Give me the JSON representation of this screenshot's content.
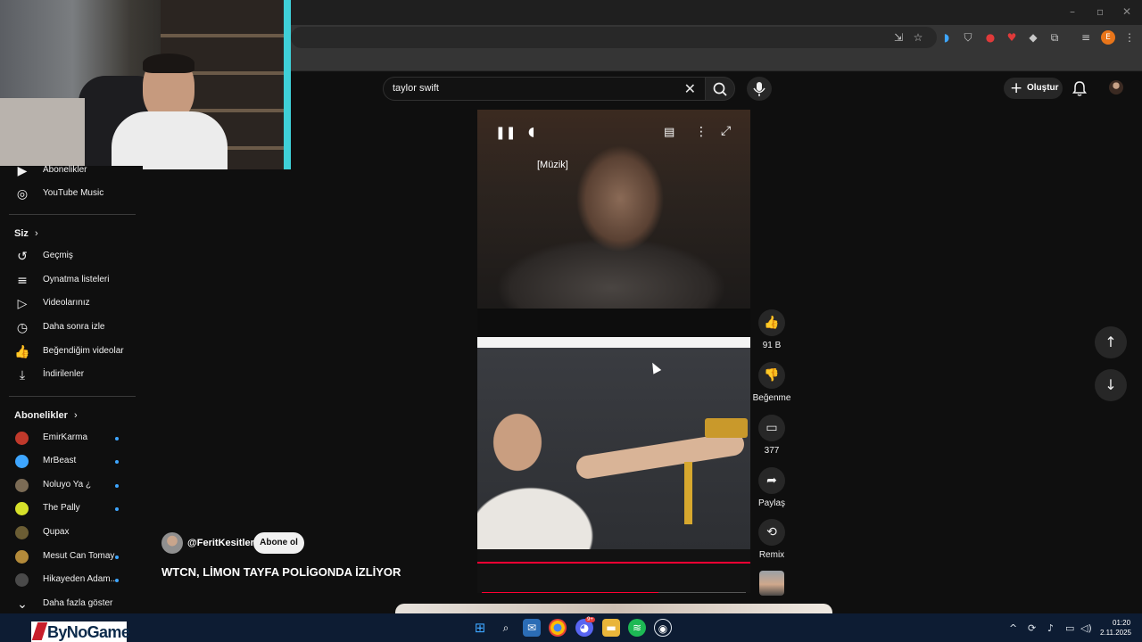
{
  "search": {
    "query": "taylor swift"
  },
  "header": {
    "create_label": "Oluştur"
  },
  "sidebar": {
    "top_items": [
      {
        "label": "Abonelikler"
      },
      {
        "label": "YouTube Music"
      }
    ],
    "you_heading": "Siz",
    "you_items": [
      {
        "label": "Geçmiş"
      },
      {
        "label": "Oynatma listeleri"
      },
      {
        "label": "Videolarınız"
      },
      {
        "label": "Daha sonra izle"
      },
      {
        "label": "Beğendiğim videolar"
      },
      {
        "label": "İndirilenler"
      }
    ],
    "subs_heading": "Abonelikler",
    "subscriptions": [
      {
        "name": "EmirKarma",
        "color": "#c0392b",
        "new": true
      },
      {
        "name": "MrBeast",
        "color": "#3ea6ff",
        "new": true
      },
      {
        "name": "Noluyo Ya ¿",
        "color": "#7b6b55",
        "new": true
      },
      {
        "name": "The Pally",
        "color": "#d6e02a",
        "new": true
      },
      {
        "name": "Qupax",
        "color": "#6b5d34",
        "new": false
      },
      {
        "name": "Mesut Can Tomay",
        "color": "#b38a3a",
        "new": true
      },
      {
        "name": "Hikayeden Adam...",
        "color": "#4a4a4a",
        "new": true
      }
    ],
    "show_more": "Daha fazla göster"
  },
  "video": {
    "caption": "[Müzik]",
    "progress": 0.67,
    "channel": "@FeritKesitler",
    "subscribe_label": "Abone ol",
    "title": "WTCN, LİMON TAYFA POLİGONDA İZLİYOR"
  },
  "actions": {
    "like_count": "91 B",
    "dislike_label": "Beğenme",
    "comment_count": "377",
    "share_label": "Paylaş",
    "remix_label": "Remix"
  },
  "taskbar": {
    "logo_text": "ByNoGame",
    "time": "01:20",
    "date": "2.11.2025",
    "discord_badge": "9+"
  },
  "colors": {
    "accent": "#ff0033",
    "subscription_dot": "#3ea6ff",
    "background": "#0f0f0f"
  }
}
